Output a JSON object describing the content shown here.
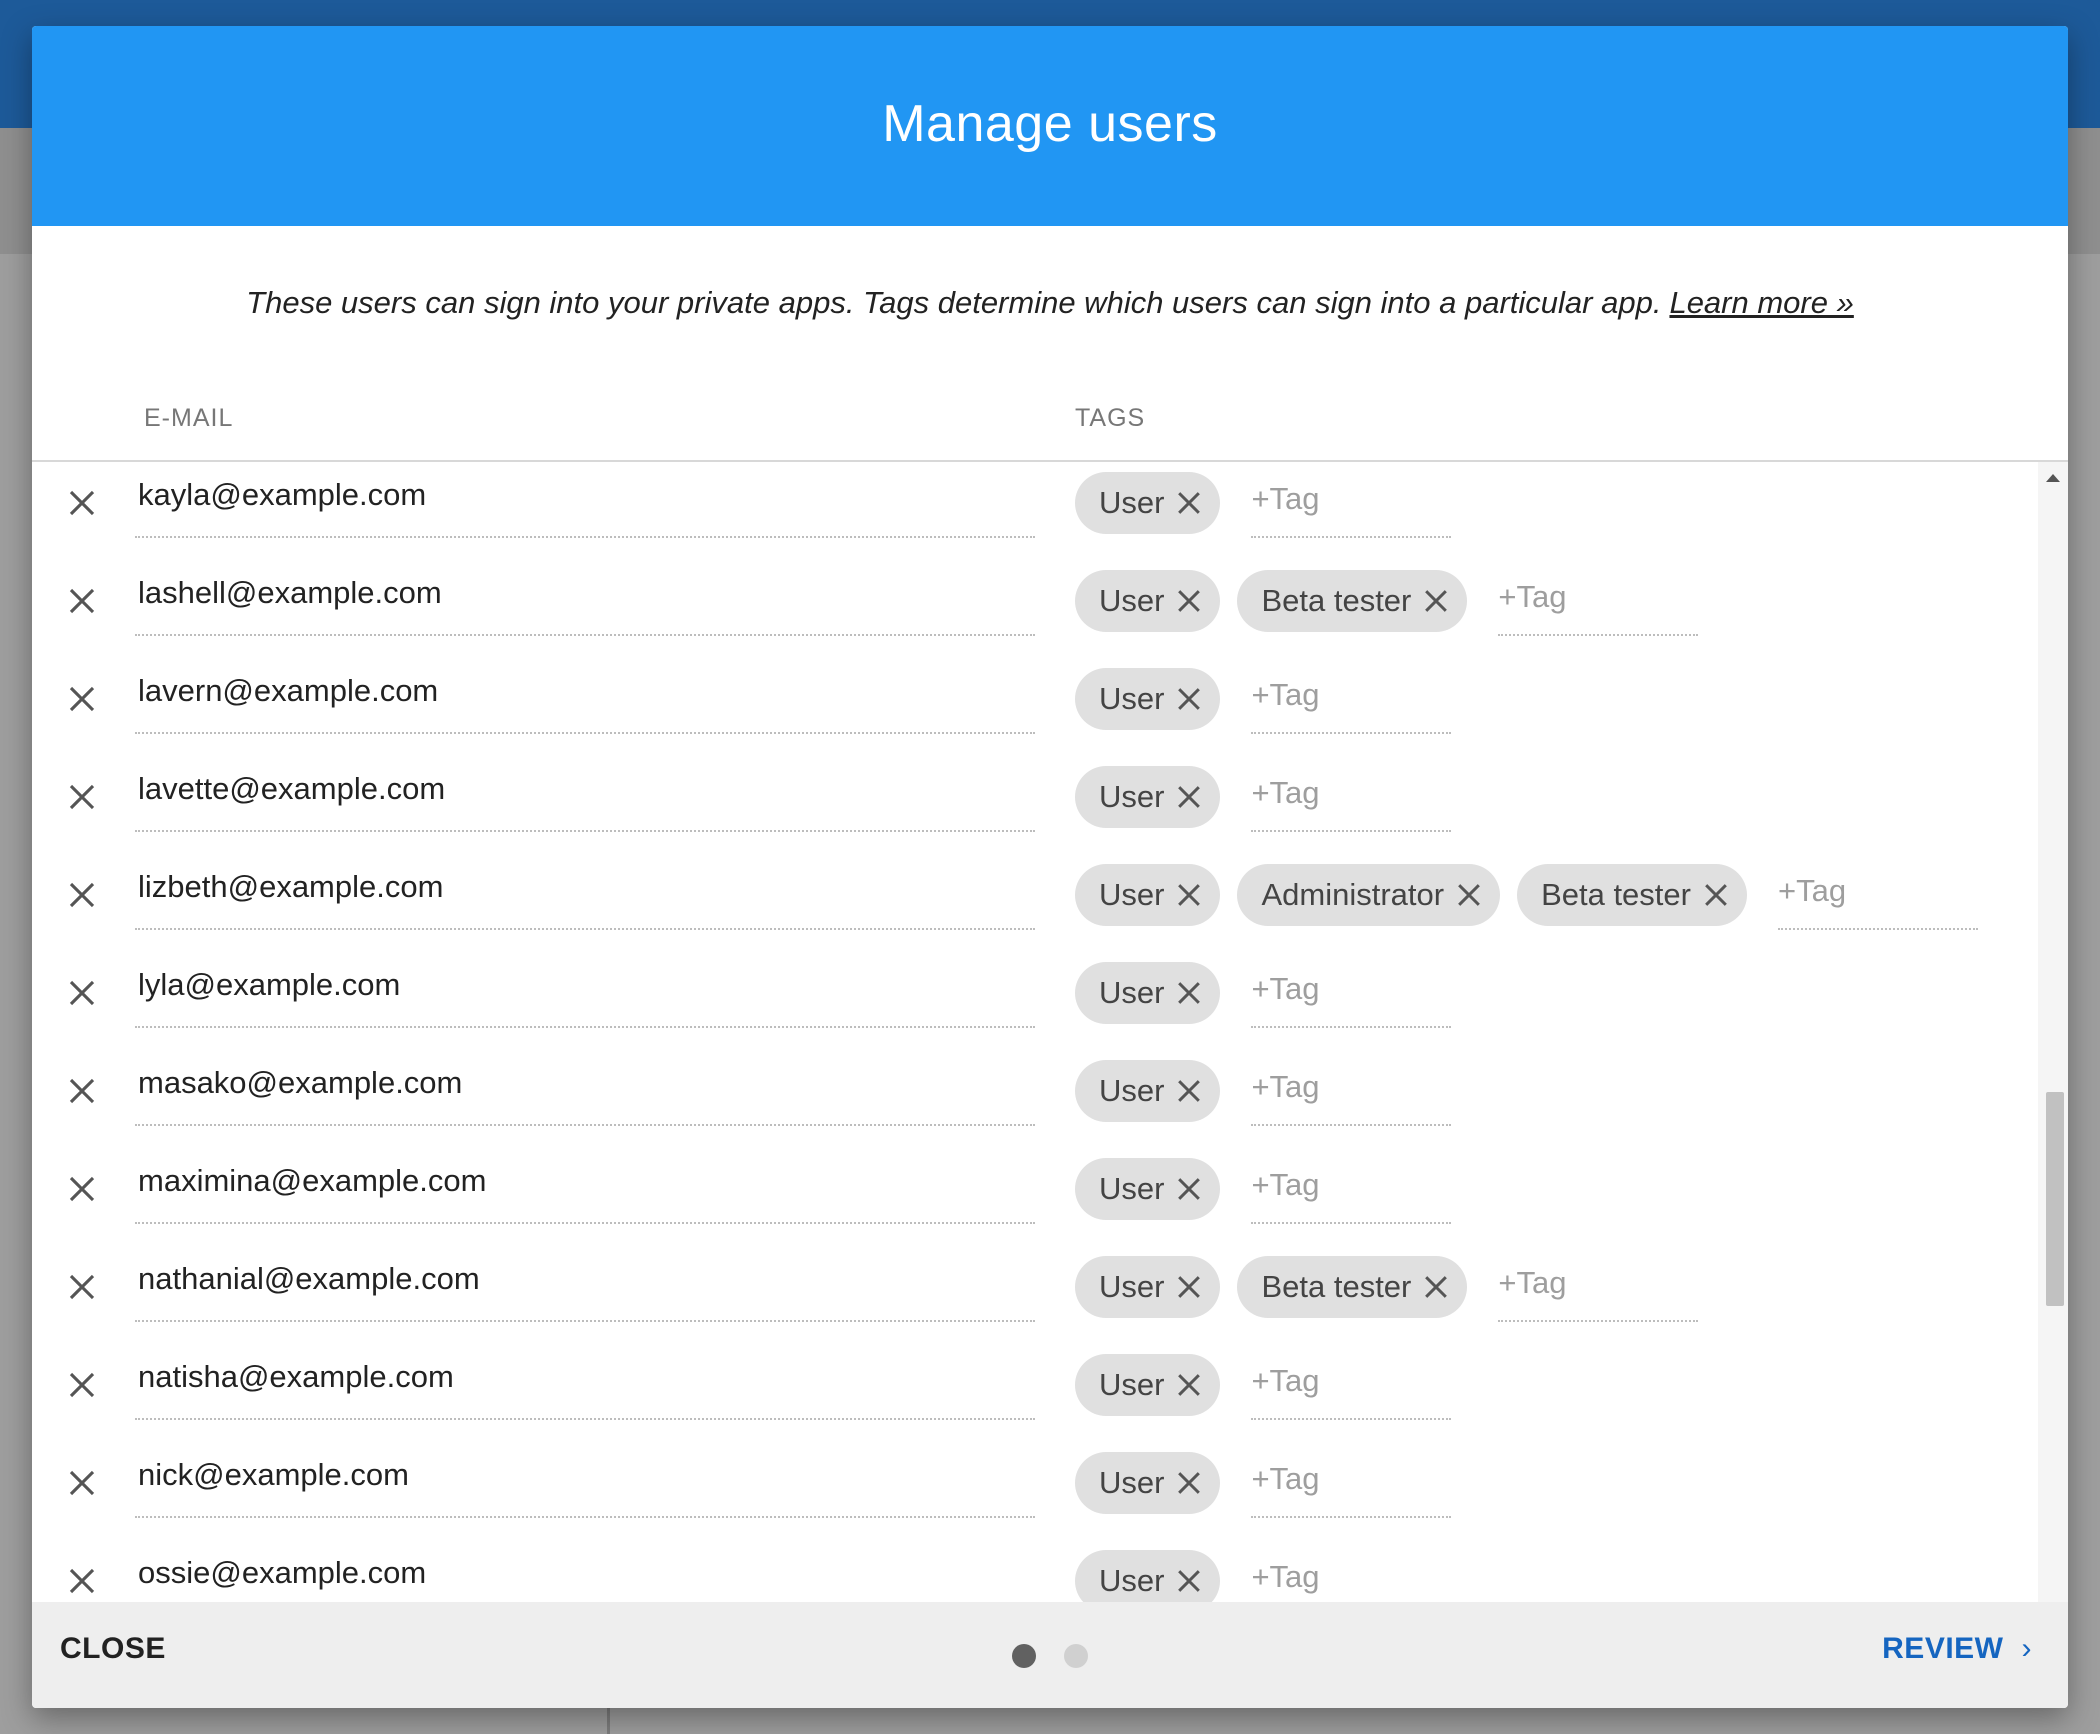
{
  "dialog": {
    "title": "Manage users",
    "intro_text": "These users can sign into your private apps. Tags determine which users can sign into a particular app.",
    "learn_more_label": "Learn more »"
  },
  "columns": {
    "email": "E-MAIL",
    "tags": "TAGS"
  },
  "tag_placeholder": "+Tag",
  "users": [
    {
      "email": "kayla@example.com",
      "tags": [
        "User"
      ]
    },
    {
      "email": "lashell@example.com",
      "tags": [
        "User",
        "Beta tester"
      ]
    },
    {
      "email": "lavern@example.com",
      "tags": [
        "User"
      ]
    },
    {
      "email": "lavette@example.com",
      "tags": [
        "User"
      ]
    },
    {
      "email": "lizbeth@example.com",
      "tags": [
        "User",
        "Administrator",
        "Beta tester"
      ]
    },
    {
      "email": "lyla@example.com",
      "tags": [
        "User"
      ]
    },
    {
      "email": "masako@example.com",
      "tags": [
        "User"
      ]
    },
    {
      "email": "maximina@example.com",
      "tags": [
        "User"
      ]
    },
    {
      "email": "nathanial@example.com",
      "tags": [
        "User",
        "Beta tester"
      ]
    },
    {
      "email": "natisha@example.com",
      "tags": [
        "User"
      ]
    },
    {
      "email": "nick@example.com",
      "tags": [
        "User"
      ]
    },
    {
      "email": "ossie@example.com",
      "tags": [
        "User"
      ]
    }
  ],
  "footer": {
    "close_label": "CLOSE",
    "review_label": "REVIEW",
    "review_chevron": "›",
    "page_dots": {
      "total": 2,
      "active": 1
    }
  },
  "colors": {
    "header_bg": "#2196f3",
    "chip_bg": "#e0e0e0",
    "review_text": "#1565c0",
    "footer_bg": "#eeeeee"
  }
}
